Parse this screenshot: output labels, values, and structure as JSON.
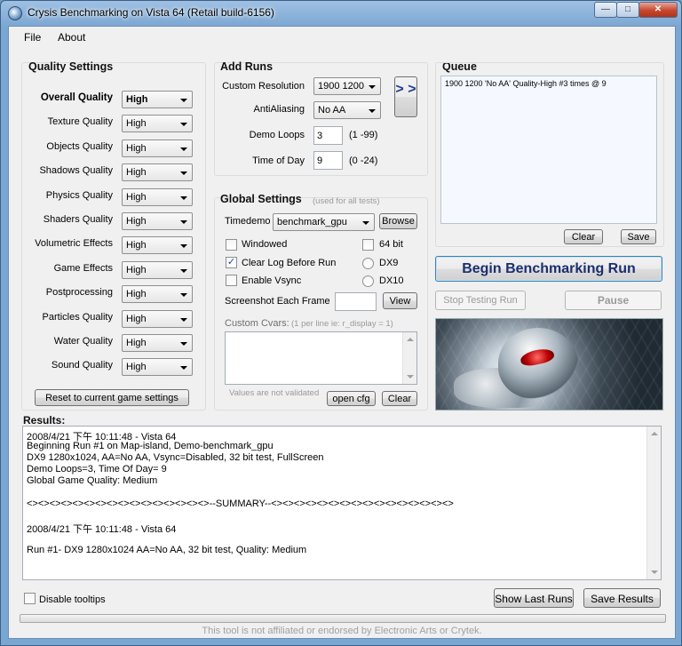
{
  "window": {
    "title": "Crysis Benchmarking on Vista 64 (Retail build-6156)"
  },
  "menu": {
    "file": "File",
    "about": "About"
  },
  "quality": {
    "title": "Quality Settings",
    "rows": [
      {
        "label": "Overall Quality",
        "value": "High"
      },
      {
        "label": "Texture Quality",
        "value": "High"
      },
      {
        "label": "Objects Quality",
        "value": "High"
      },
      {
        "label": "Shadows Quality",
        "value": "High"
      },
      {
        "label": "Physics Quality",
        "value": "High"
      },
      {
        "label": "Shaders Quality",
        "value": "High"
      },
      {
        "label": "Volumetric Effects",
        "value": "High"
      },
      {
        "label": "Game Effects",
        "value": "High"
      },
      {
        "label": "Postprocessing",
        "value": "High"
      },
      {
        "label": "Particles Quality",
        "value": "High"
      },
      {
        "label": "Water Quality",
        "value": "High"
      },
      {
        "label": "Sound Quality",
        "value": "High"
      }
    ],
    "reset_button": "Reset to current game settings"
  },
  "add_runs": {
    "title": "Add Runs",
    "resolution_label": "Custom Resolution",
    "resolution_value": "1900 1200",
    "aa_label": "AntiAliasing",
    "aa_value": "No AA",
    "loops_label": "Demo Loops",
    "loops_value": "3",
    "loops_range": "(1 -99)",
    "tod_label": "Time of Day",
    "tod_value": "9",
    "tod_range": "(0 -24)",
    "add_glyph": "> >"
  },
  "queue": {
    "title": "Queue",
    "items": [
      "1900 1200 'No AA' Quality-High #3 times @ 9"
    ],
    "clear_button": "Clear",
    "save_button": "Save"
  },
  "global": {
    "title": "Global Settings",
    "subtitle": "(used for all tests)",
    "timedemo_label": "Timedemo",
    "timedemo_value": "benchmark_gpu",
    "browse_button": "Browse",
    "windowed_label": "Windowed",
    "windowed_checked": false,
    "bit64_label": "64 bit",
    "bit64_checked": false,
    "clearlog_label": "Clear Log Before Run",
    "clearlog_checked": true,
    "dx9_label": "DX9",
    "vsync_label": "Enable Vsync",
    "vsync_checked": false,
    "dx10_label": "DX10",
    "screenshot_label": "Screenshot Each Frame",
    "view_button": "View",
    "cvars_label": "Custom Cvars:",
    "cvars_hint": "(1 per line ie: r_display = 1)",
    "cvars_note": "Values are not validated",
    "open_cfg_button": "open cfg",
    "clear_button": "Clear"
  },
  "actions": {
    "begin_button": "Begin Benchmarking Run",
    "stop_button": "Stop Testing Run",
    "pause_button": "Pause"
  },
  "results": {
    "title": "Results:",
    "lines": [
      "2008/4/21 下午 10:11:48 - Vista 64",
      "Beginning Run #1 on Map-island, Demo-benchmark_gpu",
      "DX9 1280x1024, AA=No AA, Vsync=Disabled, 32 bit test, FullScreen",
      "Demo Loops=3, Time Of Day= 9",
      "Global Game Quality: Medium",
      "",
      "<><><><><><><><><><><><><><><><>--SUMMARY--<><><><><><><><><><><><><><><><>",
      "",
      "2008/4/21 下午 10:11:48 - Vista 64",
      "",
      "Run #1- DX9 1280x1024 AA=No AA, 32 bit test, Quality: Medium"
    ]
  },
  "bottom": {
    "disable_tooltips_label": "Disable tooltips",
    "show_last_runs_button": "Show Last Runs",
    "save_results_button": "Save Results",
    "footer": "This tool is not affiliated or endorsed by Electronic Arts or Crytek."
  },
  "colors": {
    "begin_text": "#1b2f6e",
    "accent": "#3b5ea8"
  }
}
